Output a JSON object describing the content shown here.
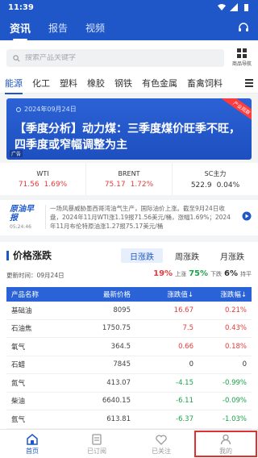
{
  "status": {
    "time": "11:39"
  },
  "header": {
    "tabs": [
      "资讯",
      "报告",
      "视频"
    ],
    "active_tab": 0
  },
  "search": {
    "placeholder": "搜索产品关键字",
    "nav_label": "商品导航"
  },
  "categories": [
    "能源",
    "化工",
    "塑料",
    "橡胶",
    "钢铁",
    "有色金属",
    "畜禽饲料"
  ],
  "active_category": 0,
  "banner": {
    "date": "2024年09月24日",
    "headline": "【季度分析】动力煤：三季度煤价旺季不旺，四季度或窄幅调整为主",
    "corner": "产业观察",
    "ad": "广告"
  },
  "tickers": [
    {
      "name": "WTI",
      "value": "71.56",
      "change": "1.69%",
      "dir": "up"
    },
    {
      "name": "BRENT",
      "value": "75.17",
      "change": "1.72%",
      "dir": "up"
    },
    {
      "name": "SC主力",
      "value": "522.9",
      "change": "0.04%",
      "dir": "flat"
    }
  ],
  "news": {
    "brand": "原油早报",
    "time": "05:24:46",
    "text": "一场风暴威胁墨西哥湾油气生产，国际油价上涨。截至9月24日收盘，2024年11月WTI涨1.19报71.56美元/桶，涨幅1.69%；2024年11月布伦特原油涨1.27报75.17美元/桶"
  },
  "price": {
    "title": "价格涨跌",
    "tabs": [
      "日涨跌",
      "周涨跌",
      "月涨跌"
    ],
    "update": "更新时间：09月24日",
    "up_pct": "19%",
    "up_label": "上涨",
    "down_pct": "75%",
    "down_label": "下跌",
    "flat_pct": "6%",
    "flat_label": "持平",
    "headers": [
      "产品名称",
      "最新价格",
      "涨跌值↓",
      "涨跌幅↓"
    ],
    "rows": [
      {
        "name": "基础油",
        "price": "8095",
        "change": "16.67",
        "pct": "0.21%",
        "dir": "up"
      },
      {
        "name": "石油焦",
        "price": "1750.75",
        "change": "7.5",
        "pct": "0.43%",
        "dir": "up"
      },
      {
        "name": "氧气",
        "price": "364.5",
        "change": "0.66",
        "pct": "0.18%",
        "dir": "up"
      },
      {
        "name": "石蜡",
        "price": "7845",
        "change": "0",
        "pct": "0",
        "dir": "flat"
      },
      {
        "name": "氮气",
        "price": "413.07",
        "change": "-4.15",
        "pct": "-0.99%",
        "dir": "down"
      },
      {
        "name": "柴油",
        "price": "6640.15",
        "change": "-6.11",
        "pct": "-0.09%",
        "dir": "down"
      },
      {
        "name": "氩气",
        "price": "613.81",
        "change": "-6.37",
        "pct": "-1.03%",
        "dir": "down"
      }
    ]
  },
  "bottom_nav": [
    {
      "label": "首页",
      "icon": "home-icon",
      "active": true
    },
    {
      "label": "已订阅",
      "icon": "subscribed-icon",
      "active": false
    },
    {
      "label": "已关注",
      "icon": "heart-icon",
      "active": false
    },
    {
      "label": "我的",
      "icon": "profile-icon",
      "active": false
    }
  ],
  "colors": {
    "brand": "#1f57c8",
    "up": "#e23b3b",
    "down": "#1aa34a"
  }
}
